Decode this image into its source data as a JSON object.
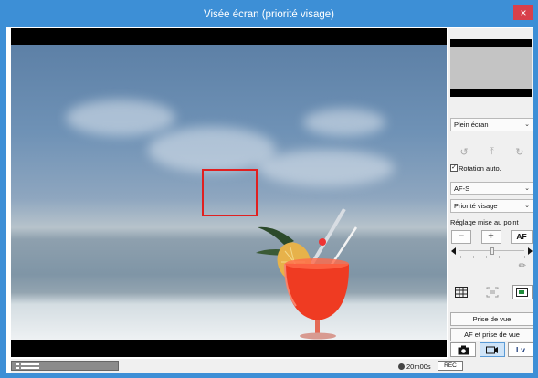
{
  "window": {
    "title": "Visée écran (priorité visage)",
    "close_label": "×"
  },
  "sidebar": {
    "display_mode": "Plein écran",
    "rotation_label": "Rotation auto.",
    "rotation_checked": true,
    "af_mode": "AF-S",
    "af_area": "Priorité visage",
    "focus_label": "Réglage mise au point",
    "focus_minus": "−",
    "focus_plus": "+",
    "focus_af": "AF",
    "shoot_button": "Prise de vue",
    "af_shoot_button": "AF et prise de vue",
    "lv_label": "Lv"
  },
  "status": {
    "time_remaining": "20m00s",
    "rec_label": "REC"
  },
  "colors": {
    "title_bar": "#3d8fd6",
    "af_frame": "#e02020",
    "active_mode": "#cfe4f8"
  }
}
